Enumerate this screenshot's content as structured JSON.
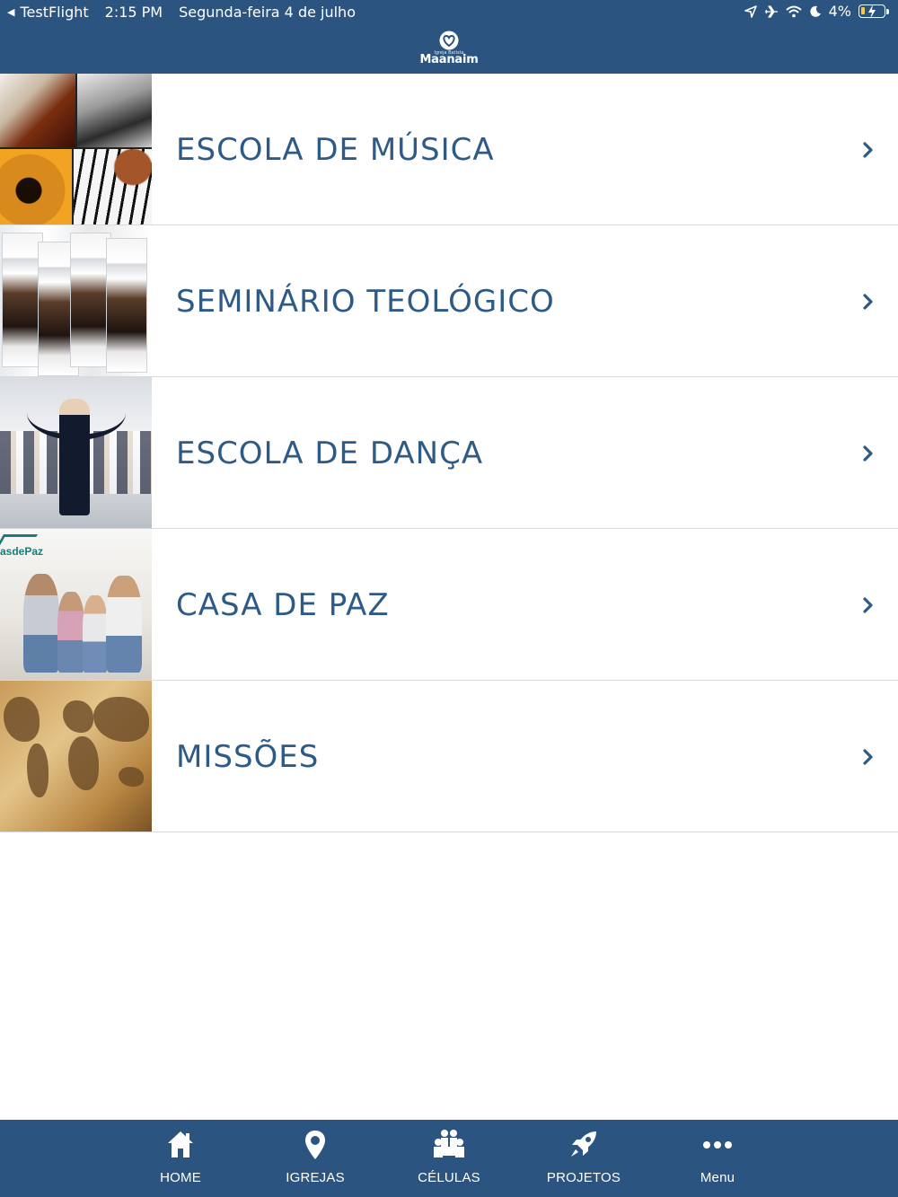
{
  "status_bar": {
    "back_app": "TestFlight",
    "time": "2:15 PM",
    "date": "Segunda-feira 4 de julho",
    "battery": "4%"
  },
  "header": {
    "logo_small": "Igreja Batista",
    "logo_text": "Maanaim"
  },
  "list": {
    "items": [
      {
        "label": "ESCOLA DE MÚSICA",
        "thumb": "music-collage"
      },
      {
        "label": "SEMINÁRIO TEOLÓGICO",
        "thumb": "theology-books"
      },
      {
        "label": "ESCOLA DE DANÇA",
        "thumb": "dance-class"
      },
      {
        "label": "CASA DE PAZ",
        "thumb": "family-home",
        "thumb_logo": "asdePaz"
      },
      {
        "label": "MISSÕES",
        "thumb": "world-map"
      }
    ]
  },
  "tabbar": {
    "tabs": [
      {
        "label": "HOME",
        "icon": "home-icon"
      },
      {
        "label": "IGREJAS",
        "icon": "map-pin-icon"
      },
      {
        "label": "CÉLULAS",
        "icon": "group-icon"
      },
      {
        "label": "PROJETOS",
        "icon": "rocket-icon"
      },
      {
        "label": "Menu",
        "icon": "more-dots-icon"
      }
    ]
  },
  "colors": {
    "primary": "#2b5580",
    "item_text": "#2d5a86",
    "divider": "#d8dadd",
    "background": "#ffffff"
  }
}
